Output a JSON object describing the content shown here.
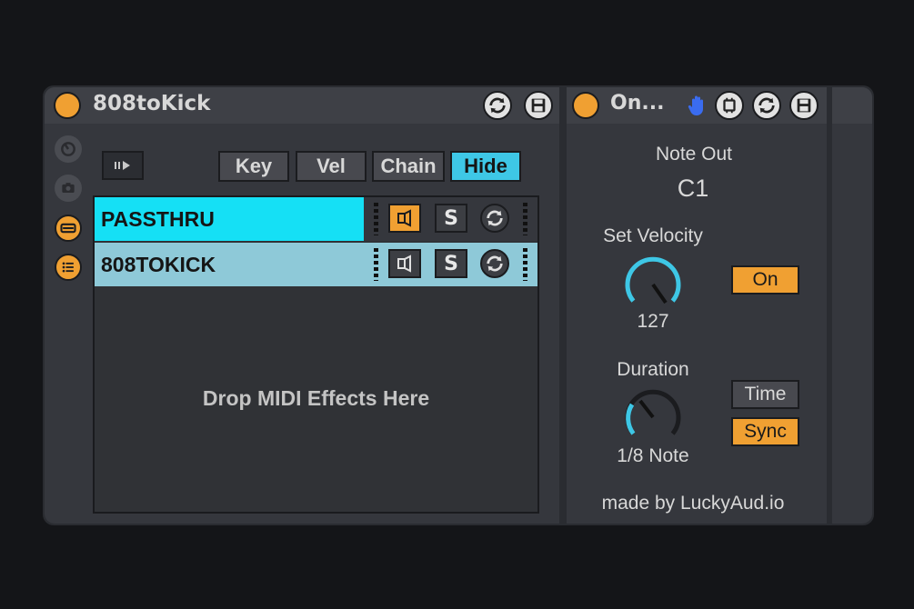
{
  "rack": {
    "title": "808toKick",
    "icons": [
      "hot-swap-icon",
      "save-preset-icon"
    ],
    "side_icons": [
      "macro-knob-icon",
      "camera-icon",
      "chain-view-icon",
      "chain-list-icon"
    ],
    "toggles": [
      {
        "label": "Key",
        "active": false
      },
      {
        "label": "Vel",
        "active": false
      },
      {
        "label": "Chain",
        "active": false
      },
      {
        "label": "Hide",
        "active": true
      }
    ],
    "chains": [
      {
        "name": "PASSTHRU",
        "color": "#15e0f5",
        "activator": "on",
        "solo": "S"
      },
      {
        "name": "808TOKICK",
        "color": "#8ec9d8",
        "activator": "off",
        "solo": "S"
      }
    ],
    "drop_text": "Drop MIDI Effects Here"
  },
  "device": {
    "title": "On...",
    "note_out_label": "Note Out",
    "note_out_value": "C1",
    "velocity_label": "Set Velocity",
    "velocity_value": "127",
    "velocity_on_label": "On",
    "duration_label": "Duration",
    "duration_value": "1/8 Note",
    "time_label": "Time",
    "sync_label": "Sync",
    "credit": "made by LuckyAud.io"
  },
  "colors": {
    "accent_orange": "#f0a032",
    "accent_cyan": "#3ec7e6",
    "chain_active": "#15e0f5",
    "panel": "#35373d"
  }
}
